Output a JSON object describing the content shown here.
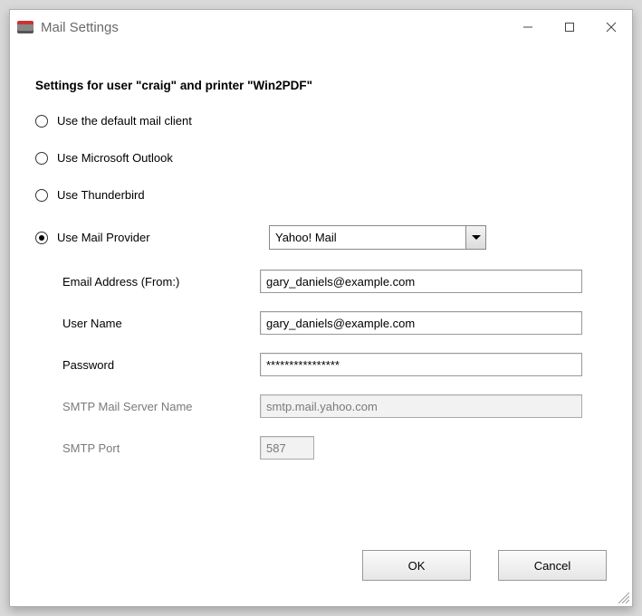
{
  "window": {
    "title": "Mail Settings"
  },
  "heading": "Settings for user \"craig\" and printer \"Win2PDF\"",
  "radios": {
    "default_client": "Use the default mail client",
    "outlook": "Use Microsoft Outlook",
    "thunderbird": "Use Thunderbird",
    "provider": "Use Mail Provider",
    "selected": "provider"
  },
  "provider_select": {
    "value": "Yahoo! Mail"
  },
  "fields": {
    "email_label": "Email Address (From:)",
    "email_value": "gary_daniels@example.com",
    "username_label": "User Name",
    "username_value": "gary_daniels@example.com",
    "password_label": "Password",
    "password_value": "****************",
    "smtp_server_label": "SMTP Mail Server Name",
    "smtp_server_value": "smtp.mail.yahoo.com",
    "smtp_port_label": "SMTP Port",
    "smtp_port_value": "587"
  },
  "buttons": {
    "ok": "OK",
    "cancel": "Cancel"
  }
}
